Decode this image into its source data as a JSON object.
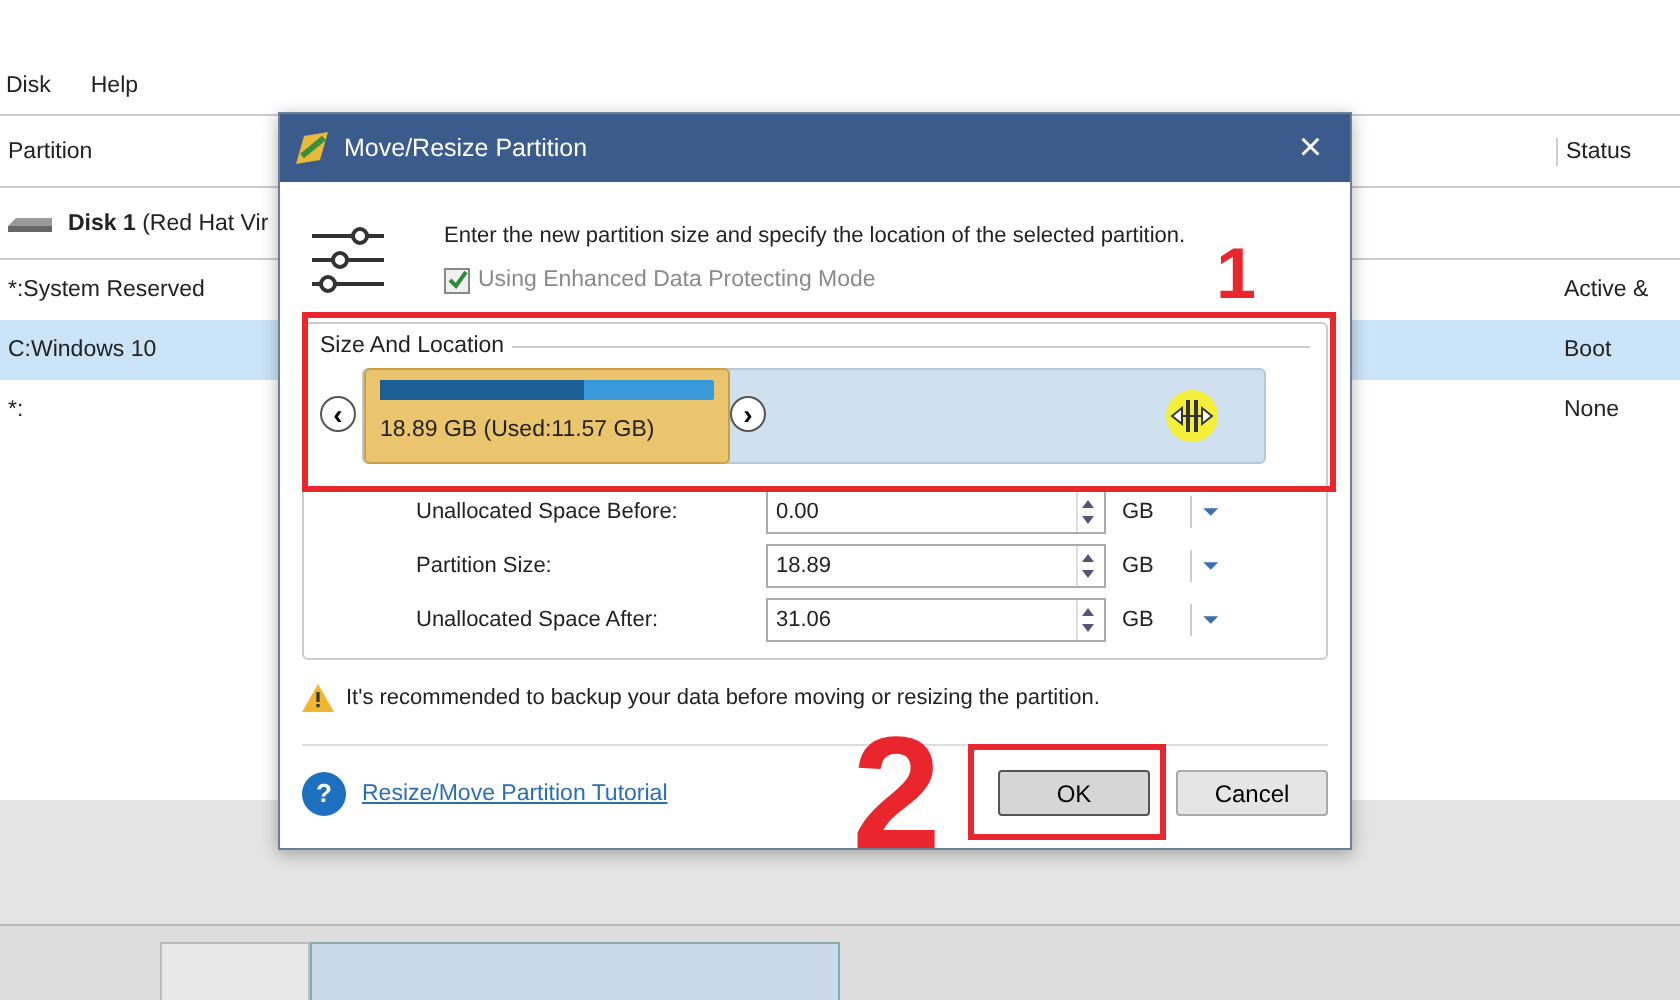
{
  "menu": [
    {
      "label": "Disk"
    },
    {
      "label": "Help"
    }
  ],
  "table": {
    "columns": [
      "Partition",
      "Status"
    ],
    "disk": {
      "name": "Disk 1",
      "detail": "(Red Hat Vir"
    },
    "rows": [
      {
        "partition": "*:System Reserved",
        "status": "Active &",
        "selected": false
      },
      {
        "partition": "C:Windows 10",
        "status": "Boot",
        "selected": true
      },
      {
        "partition": "*:",
        "status": "None",
        "selected": false
      }
    ]
  },
  "dialog": {
    "title": "Move/Resize Partition",
    "close": "×",
    "description": "Enter the new partition size and specify the location of the selected partition.",
    "checkbox": {
      "label": "Using Enhanced Data Protecting Mode",
      "checked": true,
      "disabled": true
    },
    "group_title": "Size And Location",
    "partition_bar": {
      "label": "18.89 GB (Used:11.57 GB)",
      "level": 0.61,
      "left_arrow": "‹",
      "right_arrow": "›"
    },
    "fields": [
      {
        "label": "Unallocated Space Before:",
        "value": "0.00",
        "unit": "GB"
      },
      {
        "label": "Partition Size:",
        "value": "18.89",
        "unit": "GB"
      },
      {
        "label": "Unallocated Space After:",
        "value": "31.06",
        "unit": "GB"
      }
    ],
    "warning": "It's recommended to backup your data before moving or resizing the partition.",
    "help": "?",
    "link": "Resize/Move Partition Tutorial",
    "buttons": [
      {
        "label": "OK",
        "selected": true
      },
      {
        "label": "Cancel",
        "selected": false
      }
    ]
  },
  "annotations": [
    {
      "text": "1"
    },
    {
      "text": "2"
    }
  ]
}
